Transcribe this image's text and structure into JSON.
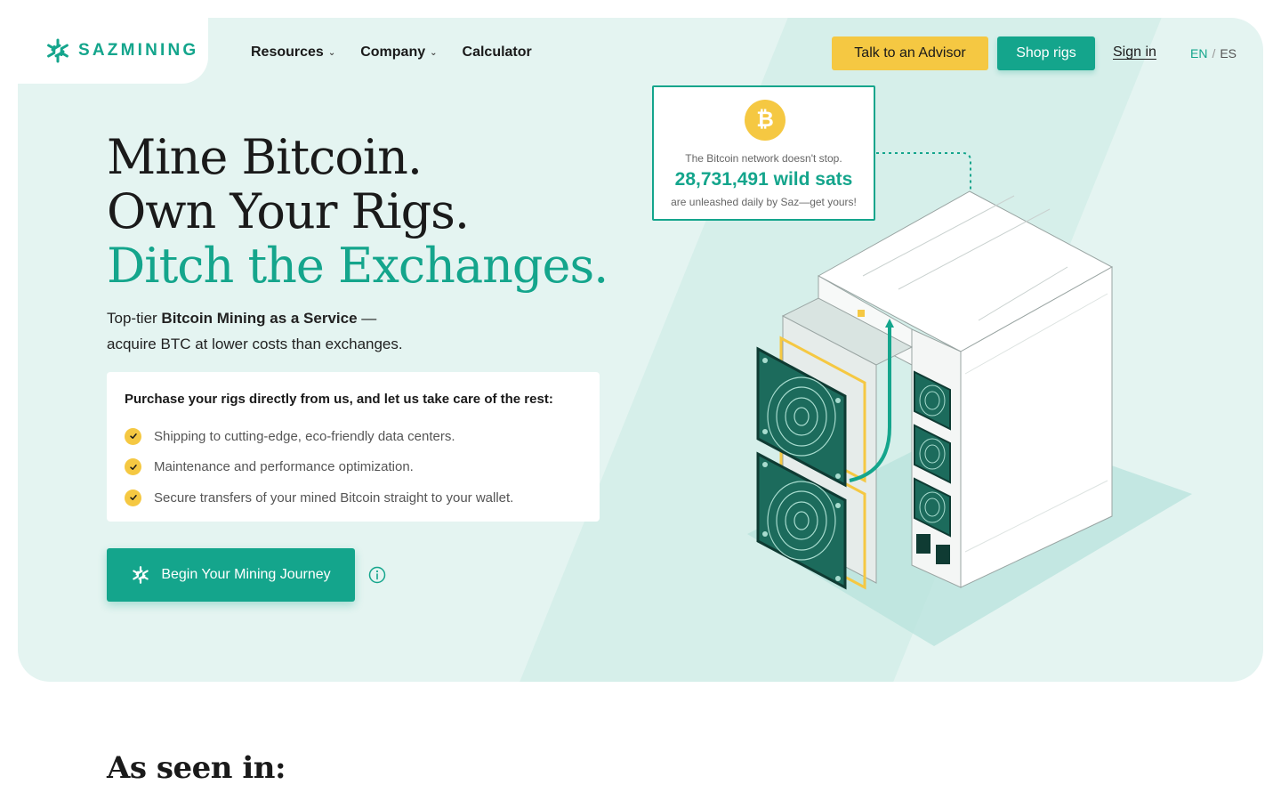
{
  "brand": {
    "name": "SAZMINING"
  },
  "nav": {
    "items": [
      {
        "label": "Resources",
        "has_dropdown": true
      },
      {
        "label": "Company",
        "has_dropdown": true
      },
      {
        "label": "Calculator",
        "has_dropdown": false
      }
    ]
  },
  "header": {
    "advisor_label": "Talk to an Advisor",
    "shop_label": "Shop rigs",
    "signin_label": "Sign in",
    "lang_en": "EN",
    "lang_sep": "/",
    "lang_es": "ES"
  },
  "hero": {
    "line1": "Mine Bitcoin.",
    "line2": "Own Your Rigs.",
    "line3": "Ditch the Exchanges.",
    "subtitle_pre": "Top-tier ",
    "subtitle_bold": "Bitcoin Mining as a Service",
    "subtitle_dash": " —",
    "subtitle_post": "acquire BTC at lower costs than exchanges."
  },
  "card": {
    "title": "Purchase your rigs directly from us, and let us take care of the rest:",
    "items": [
      "Shipping to cutting-edge, eco-friendly data centers.",
      "Maintenance and performance optimization.",
      "Secure transfers of your mined Bitcoin straight to your wallet."
    ]
  },
  "cta": {
    "begin_label": "Begin Your Mining Journey"
  },
  "sats": {
    "coin_symbol": "₿",
    "top_text": "The Bitcoin network doesn't stop.",
    "count": "28,731,491 wild sats",
    "bottom_text": "are unleashed daily by Saz—get yours!"
  },
  "section": {
    "as_seen_title": "As seen in:"
  },
  "colors": {
    "accent": "#14a58c",
    "yellow": "#f5c842",
    "hero_bg": "#e4f4f1",
    "text": "#1a1a1a"
  },
  "icons": {
    "logo": "sazmining-logo-icon",
    "check": "check-icon",
    "info": "info-icon",
    "bitcoin": "bitcoin-icon"
  }
}
